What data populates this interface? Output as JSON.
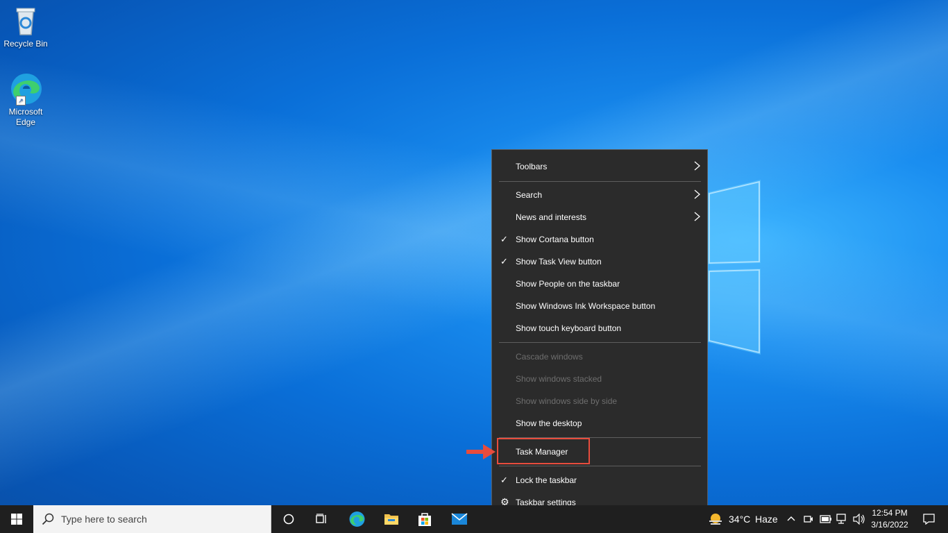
{
  "desktop": {
    "icons": [
      {
        "label": "Recycle Bin"
      },
      {
        "label": "Microsoft Edge"
      }
    ]
  },
  "context_menu": {
    "items": [
      {
        "label": "Toolbars",
        "submenu": true
      },
      {
        "label": "Search",
        "submenu": true
      },
      {
        "label": "News and interests",
        "submenu": true
      },
      {
        "label": "Show Cortana button",
        "checked": true
      },
      {
        "label": "Show Task View button",
        "checked": true
      },
      {
        "label": "Show People on the taskbar"
      },
      {
        "label": "Show Windows Ink Workspace button"
      },
      {
        "label": "Show touch keyboard button"
      },
      {
        "label": "Cascade windows",
        "disabled": true
      },
      {
        "label": "Show windows stacked",
        "disabled": true
      },
      {
        "label": "Show windows side by side",
        "disabled": true
      },
      {
        "label": "Show the desktop"
      },
      {
        "label": "Task Manager",
        "highlighted": true
      },
      {
        "label": "Lock the taskbar",
        "checked": true
      },
      {
        "label": "Taskbar settings",
        "icon": "gear-icon"
      }
    ]
  },
  "annotation": {
    "color": "#e84c3d"
  },
  "taskbar": {
    "search_placeholder": "Type here to search",
    "weather": {
      "temp": "34°C",
      "condition": "Haze"
    },
    "clock": {
      "time": "12:54 PM",
      "date": "3/16/2022"
    }
  }
}
